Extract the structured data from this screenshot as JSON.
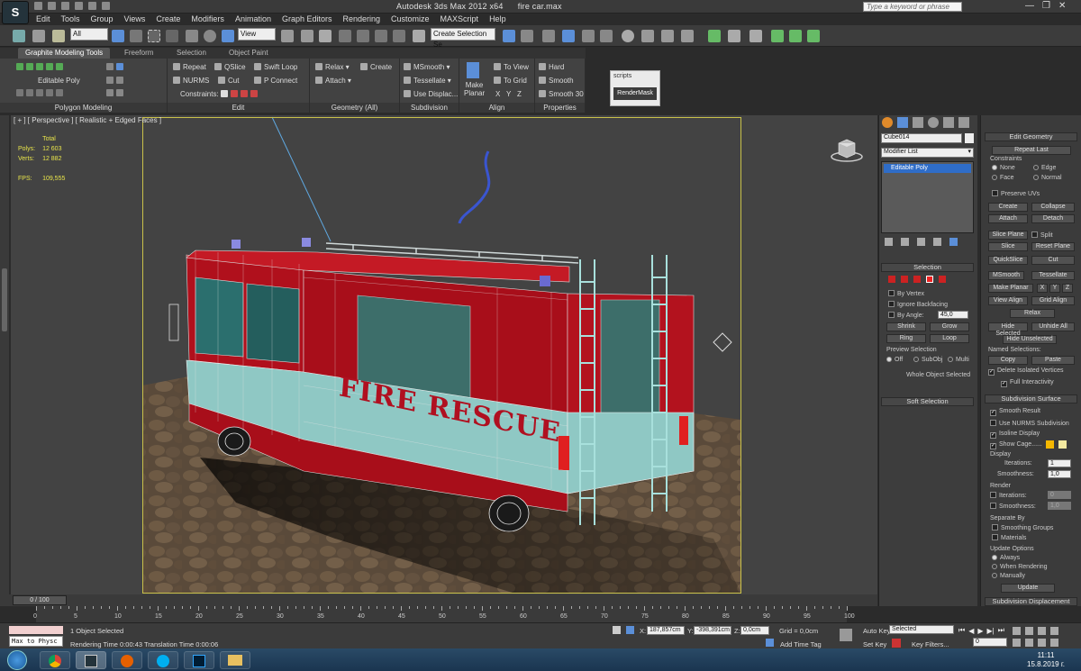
{
  "window": {
    "title_app": "Autodesk 3ds Max  2012 x64",
    "title_file": "fire car.max",
    "search_placeholder": "Type a keyword or phrase"
  },
  "menu": [
    "Edit",
    "Tools",
    "Group",
    "Views",
    "Create",
    "Modifiers",
    "Animation",
    "Graph Editors",
    "Rendering",
    "Customize",
    "MAXScript",
    "Help"
  ],
  "toolbar": {
    "selection_filter": "All",
    "ref_coord": "View",
    "named_selection": "Create Selection Se"
  },
  "ribbon": {
    "tabs": [
      "Graphite Modeling Tools",
      "Freeform",
      "Selection",
      "Object Paint"
    ],
    "poly_modeling": {
      "mode": "Editable Poly",
      "footer": "Polygon Modeling"
    },
    "edit": {
      "repeat": "Repeat",
      "qslice": "QSlice",
      "swift_loop": "Swift Loop",
      "nurms": "NURMS",
      "cut": "Cut",
      "p_connect": "P Connect",
      "constraints": "Constraints:",
      "footer": "Edit"
    },
    "geometry": {
      "relax": "Relax",
      "create": "Create",
      "attach": "Attach",
      "footer": "Geometry (All)"
    },
    "subdivision": {
      "msmooth": "MSmooth",
      "tessellate": "Tessellate",
      "use_displace": "Use Displac...",
      "footer": "Subdivision"
    },
    "align": {
      "make_planar_1": "Make",
      "make_planar_2": "Planar",
      "to_view": "To View",
      "to_grid": "To Grid",
      "x": "X",
      "y": "Y",
      "z": "Z",
      "footer": "Align"
    },
    "properties": {
      "hard": "Hard",
      "smooth": "Smooth",
      "smooth30": "Smooth 30",
      "footer": "Properties"
    },
    "scripts": {
      "title": "scripts",
      "button": "RenderMask"
    }
  },
  "viewport": {
    "label": "[ + ] [ Perspective ] [ Realistic + Edged Faces ]",
    "stats": {
      "total": "Total",
      "polys_label": "Polys:",
      "polys": "12 603",
      "verts_label": "Verts:",
      "verts": "12 882",
      "fps_label": "FPS:",
      "fps": "109,555"
    },
    "decal": "FIRE RESCUE"
  },
  "command_panel": {
    "object_name": "Cube014",
    "modifier_list": "Modifier List",
    "stack": [
      "Editable Poly"
    ],
    "selection": {
      "header": "Selection",
      "by_vertex": "By Vertex",
      "ignore_backfacing": "Ignore Backfacing",
      "by_angle": "By Angle:",
      "angle": "45,0",
      "shrink": "Shrink",
      "grow": "Grow",
      "ring": "Ring",
      "loop": "Loop",
      "preview": "Preview Selection",
      "off": "Off",
      "subobj": "SubObj",
      "multi": "Multi",
      "status": "Whole Object Selected"
    },
    "soft_selection": "Soft Selection"
  },
  "edit_geometry": {
    "header": "Edit Geometry",
    "repeat_last": "Repeat Last",
    "constraints": "Constraints",
    "none": "None",
    "edge": "Edge",
    "face": "Face",
    "normal": "Normal",
    "preserve_uvs": "Preserve UVs",
    "create": "Create",
    "collapse": "Collapse",
    "attach": "Attach",
    "detach": "Detach",
    "slice_plane": "Slice Plane",
    "split": "Split",
    "slice": "Slice",
    "reset_plane": "Reset Plane",
    "quickslice": "QuickSlice",
    "cut": "Cut",
    "msmooth": "MSmooth",
    "tessellate": "Tessellate",
    "make_planar": "Make Planar",
    "x": "X",
    "y": "Y",
    "z": "Z",
    "view_align": "View Align",
    "grid_align": "Grid Align",
    "relax": "Relax",
    "hide_selected": "Hide Selected",
    "unhide_all": "Unhide All",
    "hide_unselected": "Hide Unselected",
    "named_selections": "Named Selections:",
    "copy": "Copy",
    "paste": "Paste",
    "delete_isolated": "Delete Isolated Vertices",
    "full_interactivity": "Full Interactivity"
  },
  "subdivision_surface": {
    "header": "Subdivision Surface",
    "smooth_result": "Smooth Result",
    "use_nurms": "Use NURMS Subdivision",
    "isoline": "Isoline Display",
    "show_cage": "Show Cage......",
    "display": "Display",
    "iterations": "Iterations:",
    "iterations_val": "1",
    "smoothness": "Smoothness:",
    "smoothness_val": "1,0",
    "render": "Render",
    "r_iterations_val": "0",
    "r_smoothness_val": "1,0",
    "separate_by": "Separate By",
    "smoothing_groups": "Smoothing Groups",
    "materials": "Materials",
    "update_options": "Update Options",
    "always": "Always",
    "when_rendering": "When Rendering",
    "manually": "Manually",
    "update": "Update",
    "displacement": "Subdivision Displacement",
    "cage_color_1": "#f5b800",
    "cage_color_2": "#f3e9a0"
  },
  "timeline": {
    "slider": "0 / 100",
    "ticks": [
      "0",
      "5",
      "10",
      "15",
      "20",
      "25",
      "30",
      "35",
      "40",
      "45",
      "50",
      "55",
      "60",
      "65",
      "70",
      "75",
      "80",
      "85",
      "90",
      "95",
      "100"
    ]
  },
  "status": {
    "maxscript": "Max to Physc",
    "selected": "1 Object Selected",
    "render_time": "Rendering Time  0:00:43",
    "translation_time": "Translation Time  0:00:06",
    "x_label": "X:",
    "x": "187,857cm",
    "y_label": "Y:",
    "y": "-398,391cm",
    "z_label": "Z:",
    "z": "0,0cm",
    "grid": "Grid = 0,0cm",
    "add_time_tag": "Add Time Tag",
    "auto_key": "Auto Key",
    "set_key": "Set Key",
    "key_mode": "Selected",
    "key_filters": "Key Filters...",
    "frame": "0"
  },
  "taskbar": {
    "time": "11:11",
    "date": "15.8.2019 г."
  }
}
